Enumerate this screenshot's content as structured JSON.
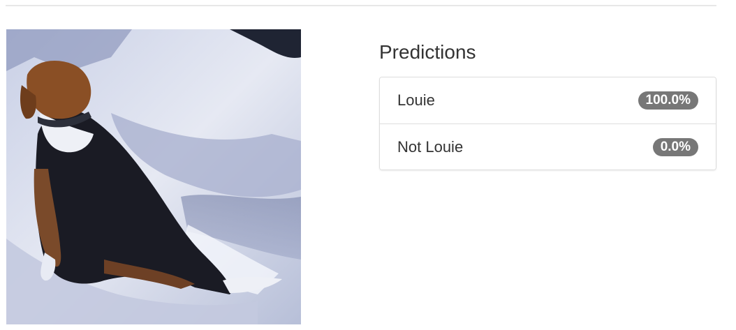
{
  "results": {
    "heading": "Predictions",
    "items": [
      {
        "label": "Louie",
        "score": "100.0%"
      },
      {
        "label": "Not Louie",
        "score": "0.0%"
      }
    ]
  },
  "image": {
    "subject": "beagle dog sitting in snow",
    "alt": "uploaded-photo"
  },
  "colors": {
    "badge_bg": "#777777",
    "badge_text": "#ffffff",
    "border": "#dddddd",
    "divider": "#e7e7e7",
    "text": "#333333"
  }
}
